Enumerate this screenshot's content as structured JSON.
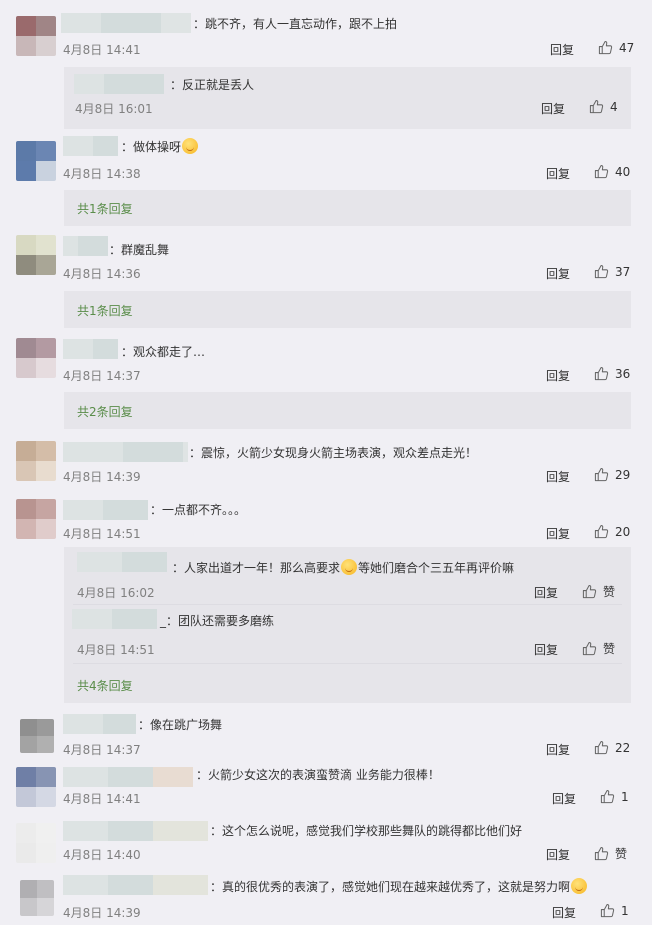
{
  "labels": {
    "reply": "回复",
    "like_word": "赞"
  },
  "comments": [
    {
      "text": "：跳不齐，有人一直忘动作，跟不上拍",
      "time": "4月8日 14:41",
      "likes": "47",
      "replies": [
        {
          "text": "：反正就是丢人",
          "time": "4月8日 16:01",
          "likes": "4"
        }
      ]
    },
    {
      "text": "：做体操呀",
      "time": "4月8日 14:38",
      "likes": "40",
      "more": "共1条回复"
    },
    {
      "text": "：群魔乱舞",
      "time": "4月8日 14:36",
      "likes": "37",
      "more": "共1条回复"
    },
    {
      "text": "：观众都走了…",
      "time": "4月8日 14:37",
      "likes": "36",
      "more": "共2条回复"
    },
    {
      "text": "：震惊，火箭少女现身火箭主场表演，观众差点走光！",
      "time": "4月8日 14:39",
      "likes": "29"
    },
    {
      "text": "：一点都不齐。。。",
      "time": "4月8日 14:51",
      "likes": "20",
      "more": "共4条回复",
      "replies": [
        {
          "text_a": "：人家出道才一年！那么高要求",
          "text_b": "等她们磨合个三五年再评价嘛",
          "time": "4月8日 16:02",
          "likes": "赞"
        },
        {
          "text": "_：团队还需要多磨练",
          "time": "4月8日 14:51",
          "likes": "赞"
        }
      ]
    },
    {
      "text": "：像在跳广场舞",
      "time": "4月8日 14:37",
      "likes": "22"
    },
    {
      "text": "：火箭少女这次的表演蛮赞滴  业务能力很棒！",
      "time": "4月8日 14:41",
      "likes": "1"
    },
    {
      "text": "：这个怎么说呢，感觉我们学校那些舞队的跳得都比他们好",
      "time": "4月8日 14:40",
      "likes": "赞"
    },
    {
      "text": "：真的很优秀的表演了，感觉她们现在越来越优秀了，这就是努力啊",
      "time": "4月8日 14:39",
      "likes": "1"
    }
  ],
  "colors": {
    "background": "#f0eff4",
    "reply_box": "#e6e5ea",
    "more_link": "#5a8d4a",
    "time": "#808080"
  }
}
